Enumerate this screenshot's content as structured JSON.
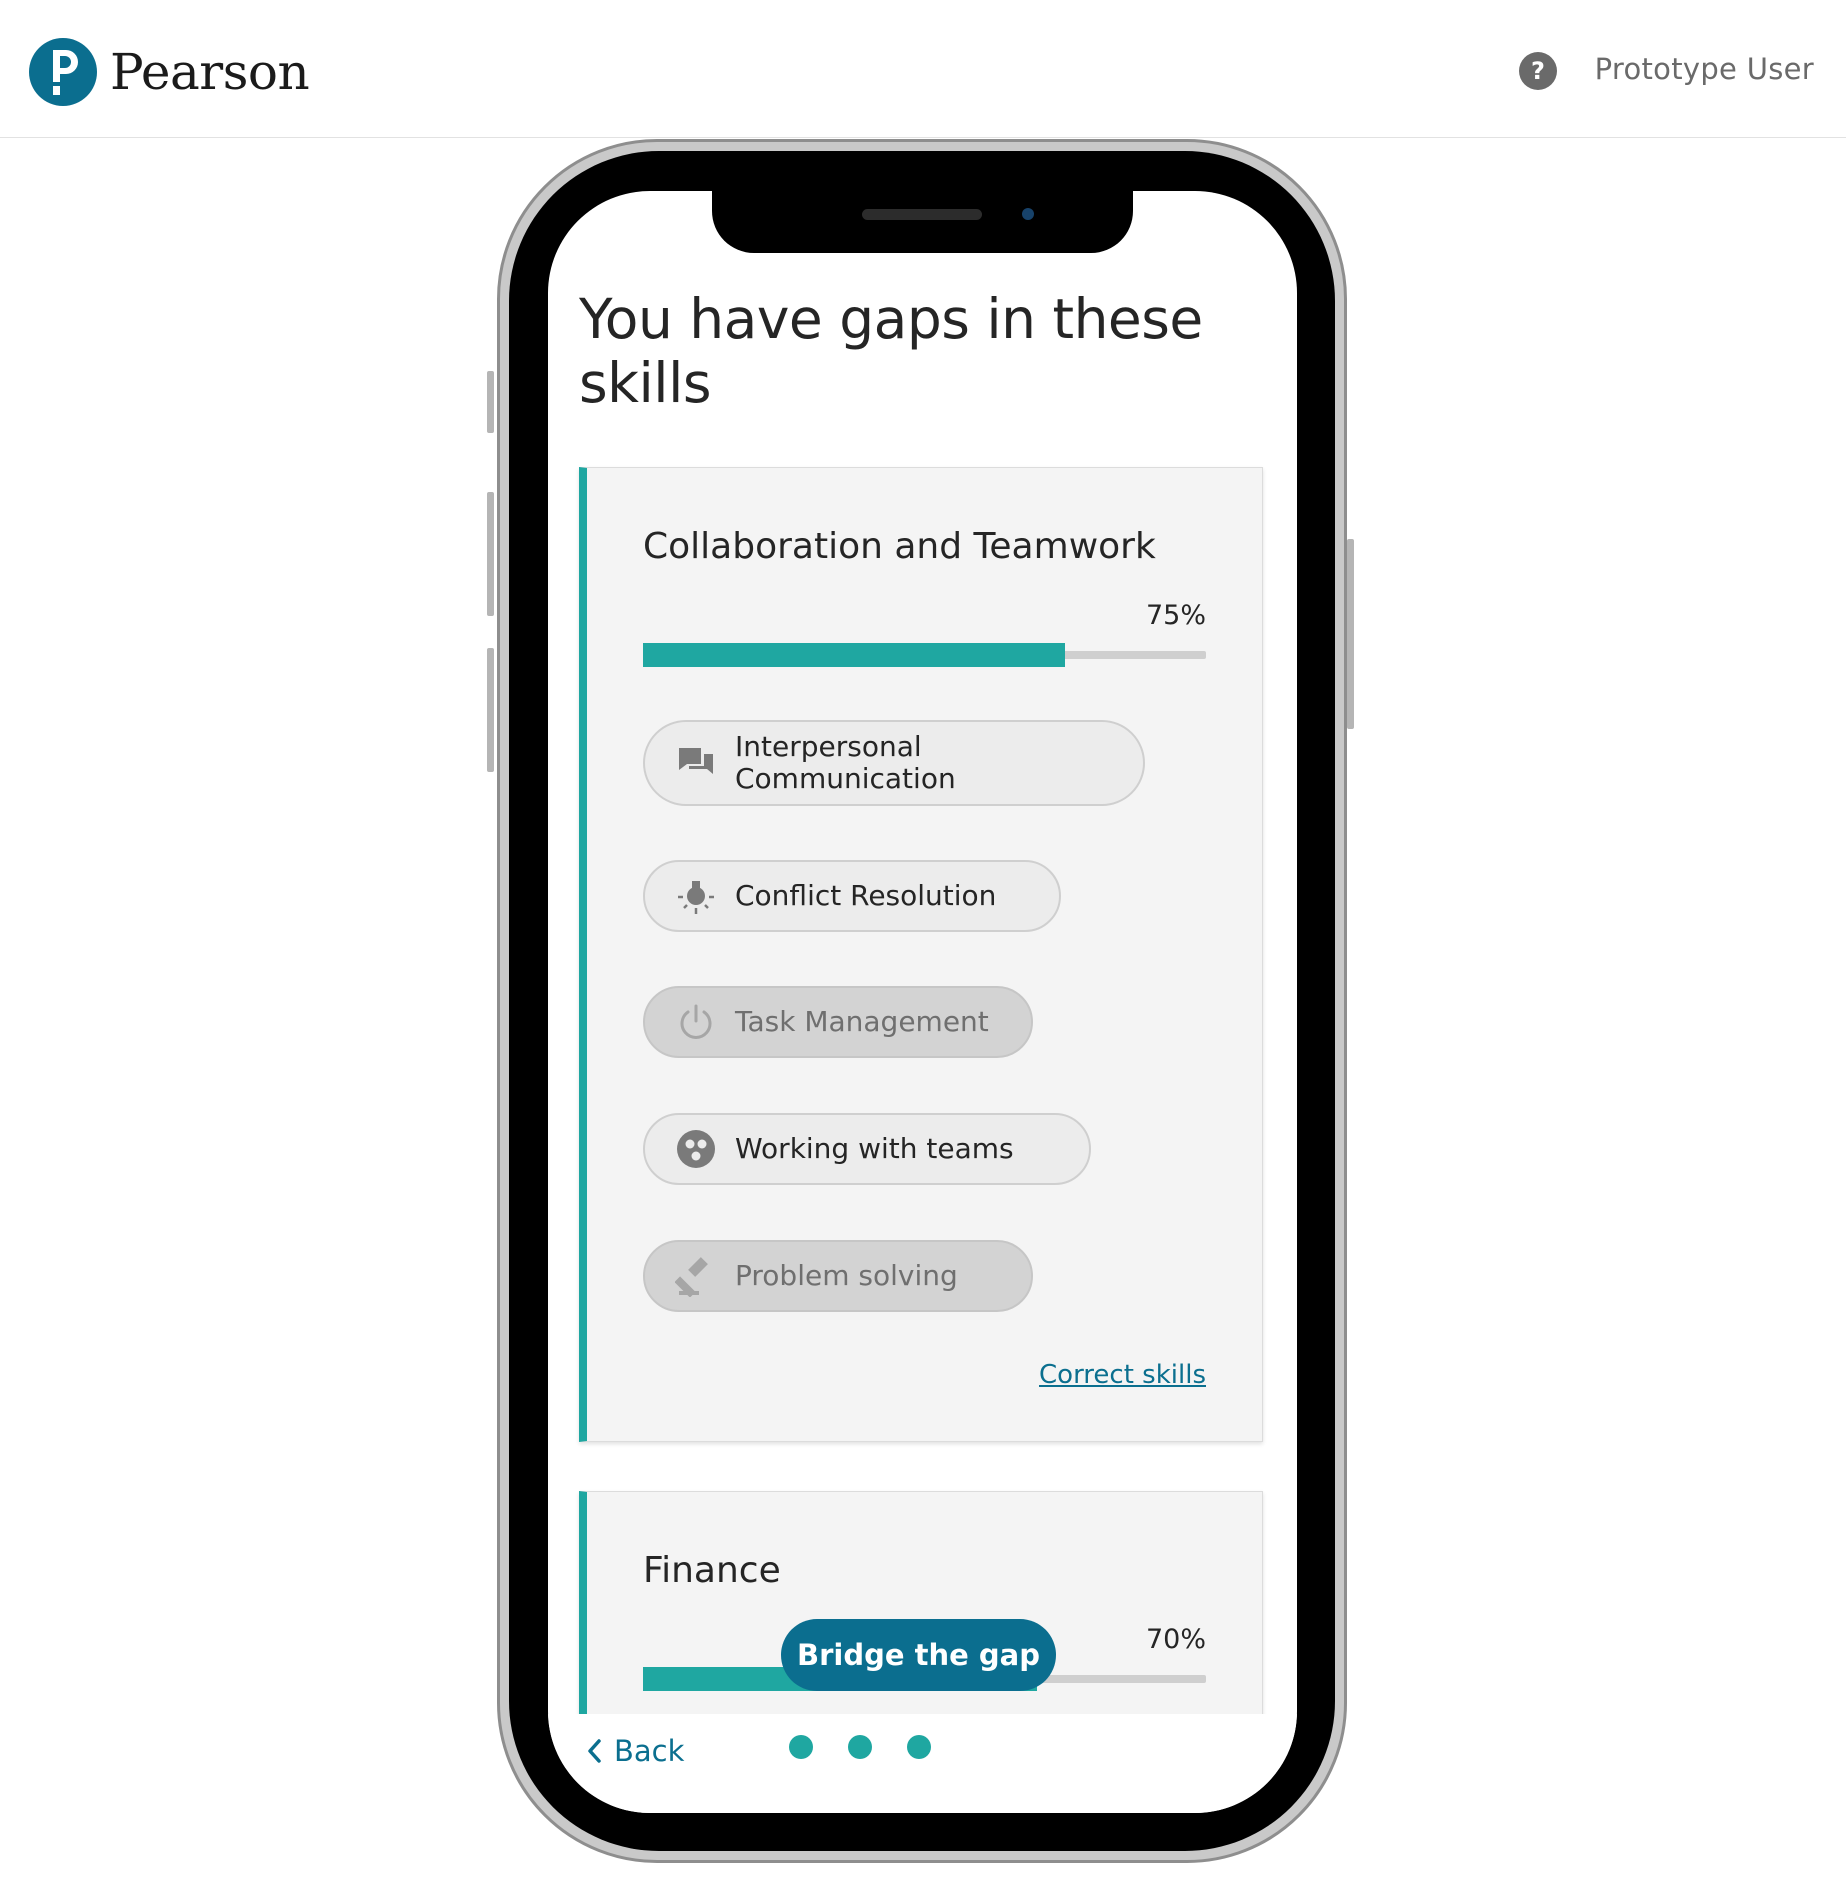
{
  "header": {
    "brand": "Pearson",
    "help_icon": "question-circle-icon",
    "help_glyph": "?",
    "user_name": "Prototype User"
  },
  "screen": {
    "headline": "You have gaps in these skills",
    "cards": [
      {
        "title": "Collaboration and Teamwork",
        "percent": "75%",
        "progress": 0.75,
        "skills": [
          {
            "label_line1": "Interpersonal",
            "label_line2": "Communication",
            "icon": "chat-bubbles-icon",
            "dimmed": false
          },
          {
            "label": "Conflict Resolution",
            "icon": "lightbulb-icon",
            "dimmed": false
          },
          {
            "label": "Task Management",
            "icon": "power-icon",
            "dimmed": true
          },
          {
            "label": "Working with teams",
            "icon": "team-icon",
            "dimmed": false
          },
          {
            "label": "Problem solving",
            "icon": "gavel-icon",
            "dimmed": true
          }
        ],
        "correct_link": "Correct skills"
      },
      {
        "title": "Finance",
        "percent": "70%",
        "progress": 0.7
      }
    ],
    "bridge_button": "Bridge the gap",
    "back_label": "Back",
    "pagination_dots": 3
  },
  "colors": {
    "accent_teal": "#1fa7a1",
    "brand_blue": "#0b6e8f",
    "card_bg": "#f4f4f4"
  }
}
